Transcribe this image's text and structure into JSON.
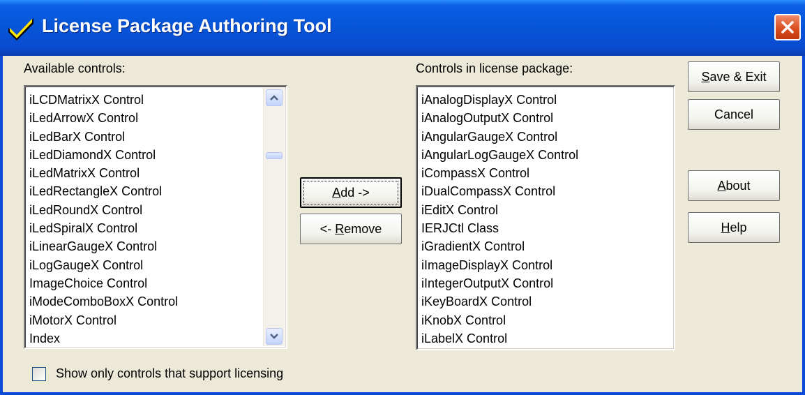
{
  "window": {
    "title": "License Package Authoring Tool",
    "accent": "#0a4bd8",
    "close_color": "#d84a1c"
  },
  "available": {
    "label": "Available controls:",
    "items": [
      "iLCDMatrixX Control",
      "iLedArrowX Control",
      "iLedBarX Control",
      "iLedDiamondX Control",
      "iLedMatrixX Control",
      "iLedRectangleX Control",
      "iLedRoundX Control",
      "iLedSpiralX Control",
      "iLinearGaugeX Control",
      "iLogGaugeX Control",
      "ImageChoice Control",
      "iModeComboBoxX Control",
      "iMotorX Control",
      "Index"
    ],
    "scroll_position_fraction": 0.38
  },
  "package": {
    "label": "Controls in license package:",
    "items": [
      "iAnalogDisplayX Control",
      "iAnalogOutputX Control",
      "iAngularGaugeX Control",
      "iAngularLogGaugeX Control",
      "iCompassX Control",
      "iDualCompassX Control",
      "iEditX Control",
      "IERJCtl Class",
      "iGradientX Control",
      "iImageDisplayX Control",
      "iIntegerOutputX Control",
      "iKeyBoardX Control",
      "iKnobX Control",
      "iLabelX Control"
    ]
  },
  "buttons": {
    "add": {
      "pre": "",
      "mnemonic": "A",
      "post": "dd ->"
    },
    "remove": {
      "pre": "<- ",
      "mnemonic": "R",
      "post": "emove"
    },
    "save_exit": {
      "pre": "",
      "mnemonic": "S",
      "post": "ave & Exit"
    },
    "cancel": "Cancel",
    "about": {
      "pre": "",
      "mnemonic": "A",
      "post": "bout"
    },
    "help": {
      "pre": "",
      "mnemonic": "H",
      "post": "elp"
    }
  },
  "options": {
    "licensing_only_label": "Show only controls that support licensing",
    "licensing_only_checked": false
  },
  "icons": {
    "title_icon": "checkmark-icon",
    "close_icon": "close-icon",
    "scroll_up": "chevron-up-icon",
    "scroll_down": "chevron-down-icon"
  }
}
